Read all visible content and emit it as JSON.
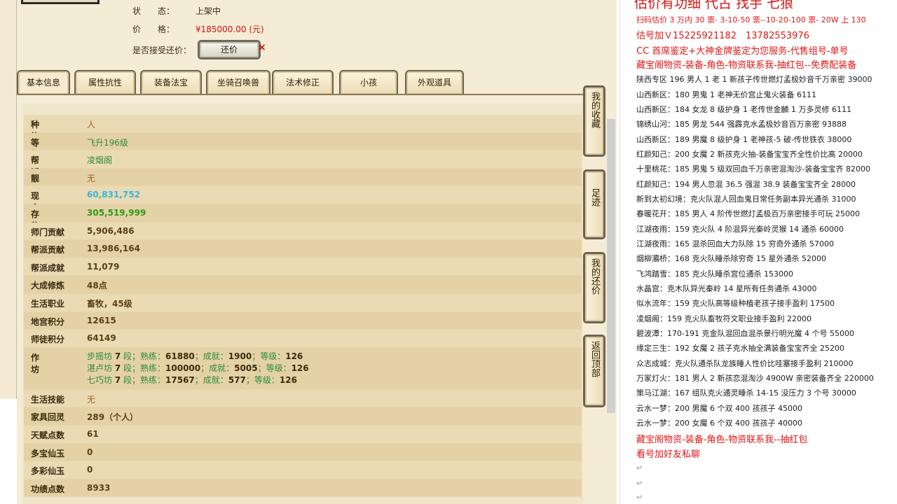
{
  "top_info": {
    "status_label": "状　　态：",
    "status_value": "上架中",
    "price_label": "价　　格：",
    "price_value": "¥185000.00 (元)",
    "counter_label": "是否接受还价：",
    "counter_button": "还价",
    "counter_close": "×"
  },
  "tabs": [
    "基本信息",
    "属性抗性",
    "装备法宝",
    "坐骑召唤兽",
    "法术修正",
    "小孩",
    "外观道具"
  ],
  "table": [
    {
      "key": "种　族",
      "value": "人"
    },
    {
      "key": "等　级",
      "value": "飞升196级"
    },
    {
      "key": "帮　派",
      "value": "凌烟阁"
    },
    {
      "key": "靓　号",
      "value": "无"
    },
    {
      "key": "现　金",
      "value": "60,831,752"
    },
    {
      "key": "存　款",
      "value": "305,519,999"
    },
    {
      "key": "师门贡献",
      "value": "5,906,486"
    },
    {
      "key": "帮派贡献",
      "value": "13,986,164"
    },
    {
      "key": "帮派成就",
      "value": "11,079"
    },
    {
      "key": "大成修炼",
      "value": "48点"
    },
    {
      "key": "生活职业",
      "value": "畜牧，45级"
    },
    {
      "key": "地宫积分",
      "value": "12615"
    },
    {
      "key": "师徒积分",
      "value": "64149"
    }
  ],
  "craft": {
    "key": "作　坊",
    "lines": [
      {
        "name": "步摇坊",
        "rank": "7",
        "rest": " 段；熟练：",
        "skill": "61880",
        "a": "；成就：",
        "ach": "1900",
        "b": "；等级：",
        "lvl": "126"
      },
      {
        "name": "湛卢坊",
        "rank": "7",
        "rest": " 段；熟练：",
        "skill": "100000",
        "a": "；成就：",
        "ach": "5005",
        "b": "；等级：",
        "lvl": "126"
      },
      {
        "name": "七巧坊",
        "rank": "7",
        "rest": " 段；熟练：",
        "skill": "17567",
        "a": "；成就：",
        "ach": "577",
        "b": "；等级：",
        "lvl": "126"
      }
    ]
  },
  "table2": [
    {
      "key": "生活技能",
      "value": "无"
    },
    {
      "key": "家具回灵",
      "value": "289（个人）"
    },
    {
      "key": "天赋点数",
      "value": "61"
    },
    {
      "key": "多宝仙玉",
      "value": "0"
    },
    {
      "key": "多彩仙玉",
      "value": "0"
    },
    {
      "key": "功绩点数",
      "value": "8933"
    }
  ],
  "side_buttons": [
    "我的收藏",
    "足迹",
    "我的还价",
    "返回顶部"
  ],
  "promo": {
    "title": "估价有功细 代古 找手 七狼",
    "lines": [
      {
        "text": "扫码估价 3 万内 30 票- 3-10-50 票--10-20-100 票- 20W 上 130",
        "red": true,
        "small": true
      },
      {
        "text": "估号加Ｖ15225921182　13782553976",
        "red": true
      },
      {
        "text": "CC 首席鉴定+大神金牌鉴定为您服务-代售组号-单号",
        "red": true
      },
      {
        "text": "藏宝阁物资-装备-角色-物资联系我-抽红包--免费配装备",
        "red": true
      },
      {
        "text": "陕西专区 196 男人 1 老 1 新孩子传世燃灯孟极妙音千万亲密 39000"
      },
      {
        "text": "山西新区：180 男鬼 1 老神无价宫止鬼火装备 6111"
      },
      {
        "text": "山西新区：184 女龙 8 级护身 1 老传世金麟 1 万多灵修 6111"
      },
      {
        "text": "锦绣山河：185 男龙 544 强霹克水孟极妙音百万亲密 93888"
      },
      {
        "text": "山西新区：189 男魔 8 级护身 1 老神孩-5 破-传世铁衣 38000"
      },
      {
        "text": "红颜知己：200 女魔 2 新孩克火抽-装备宝宝齐全性价比高 20000"
      },
      {
        "text": "十里桃花：185 男鬼 5 级双回血千万亲密混淘沙-装备宝宝齐 82000"
      },
      {
        "text": "红颜知己：194 男人忽混 36.5 强混 38.9 装备宝宝齐全 28000"
      },
      {
        "text": "新到太初幻境：克火队混人回血鬼日常任务副本异光通杀 31000"
      },
      {
        "text": "春暖花开：185 男人 4 阶传世燃灯孟极百万亲密接手可玩 25000"
      },
      {
        "text": "江湖夜雨：159 克火队 4 阶混异光秦岭灵猴 14 通杀 60000"
      },
      {
        "text": "江湖夜雨：165 混杀回血大力队除 15 穷奇外通杀 57000"
      },
      {
        "text": "烟柳灞桥：168 克火队睡杀除穷奇 15 星外通杀 52000"
      },
      {
        "text": "飞鸿踏雪：185 克火队睡杀宫位通杀 153000"
      },
      {
        "text": "水晶宫：克木队异光秦岭 14 星所有任务通杀 43000"
      },
      {
        "text": "似水流年：159 克火队高等级种植老孩子接手盈利 17500"
      },
      {
        "text": "凌烟阁：159 克火队畜牧符文职业接手盈利 22000"
      },
      {
        "text": "碧波潭：170-191 克金队混回血混杀景行明光魔 4 个号 55000"
      },
      {
        "text": "缘定三生：192 女魔 2 孩子克水抽全满装备宝宝齐全 25200"
      },
      {
        "text": "众志成城：克火队通杀队龙族睡人性价比哇塞接手盈利 210000"
      },
      {
        "text": "万家灯火：181 男人 2 新孩恋混淘沙 4900W 亲密装备齐全 220000"
      },
      {
        "text": "策马江湖：167 组队克火通灵睡杀 14-15 没压力 3 个号 30000"
      },
      {
        "text": "云水一梦：200 男魔 6 个双 400 孩孩子 45000"
      },
      {
        "text": "云水一梦：200 女魔 6 个双 400 孩孩子 40000"
      },
      {
        "text": "藏宝阁物资-装备-角色-物资联系我--抽红包",
        "red": true
      },
      {
        "text": "看号加好友私聊",
        "red": true
      }
    ],
    "para_mark": "↵"
  },
  "colors": {
    "accent_red": "#e01616",
    "panel_bg": "#f5ecd6",
    "value_green": "#2f8a3a",
    "cash_cyan": "#39b6d8"
  }
}
